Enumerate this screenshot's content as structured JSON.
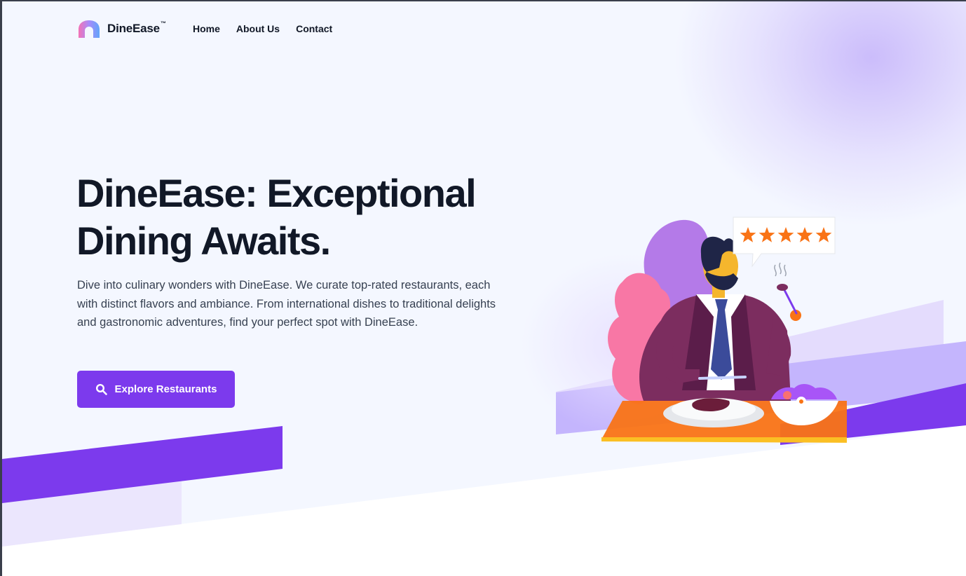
{
  "brand": {
    "name": "DineEase",
    "trademark": "™"
  },
  "nav": {
    "items": [
      {
        "label": "Home"
      },
      {
        "label": "About Us"
      },
      {
        "label": "Contact"
      }
    ]
  },
  "hero": {
    "title_line1": "DineEase: Exceptional",
    "title_line2": "Dining Awaits.",
    "description": "Dive into culinary wonders with DineEase. We curate top-rated restaurants, each with distinct flavors and ambiance. From international dishes to traditional delights and gastronomic adventures, find your perfect spot with DineEase.",
    "cta_label": "Explore Restaurants",
    "cta_icon": "search-icon"
  },
  "illustration": {
    "rating_stars": 5,
    "icons": [
      "star-icon",
      "man-dining-illustration"
    ]
  },
  "colors": {
    "accent": "#7c3aed",
    "accent_light": "#c4b5fd",
    "hero_bg": "#f4f7ff",
    "text_dark": "#111827",
    "text_body": "#374151",
    "star": "#f97316"
  }
}
